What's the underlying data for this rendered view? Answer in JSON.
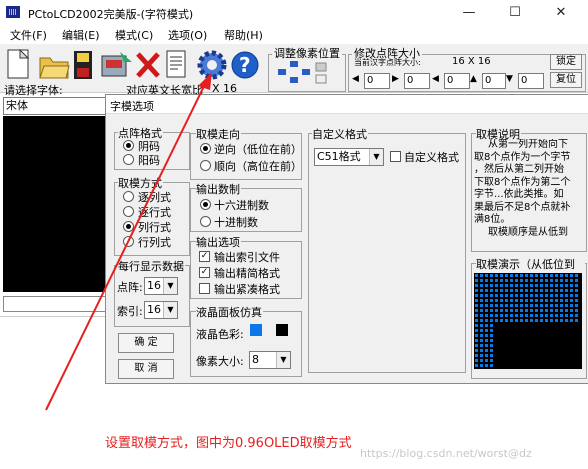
{
  "window": {
    "title": "PCtoLCD2002完美版-(字符模式)"
  },
  "menu": [
    "文件(F)",
    "编辑(E)",
    "模式(C)",
    "选项(O)",
    "帮助(H)"
  ],
  "toolbar": {
    "pixel_group_label": "调整像素位置",
    "size_group_label": "修改点阵大小",
    "size_sub_label": "当前汉字点阵大小:",
    "size_value": "16 X 16",
    "lock_label": "锁定",
    "reset_label": "复位",
    "spin_values": [
      "0",
      "0",
      "0",
      "0",
      "0"
    ]
  },
  "left_panel": {
    "font_label": "请选择字体:",
    "font_value": "宋体",
    "width_text": "对应英文长宽比",
    "width_value": "X 16"
  },
  "dialog": {
    "title": "字模选项",
    "dot_format": {
      "label": "点阵格式",
      "options": [
        "阴码",
        "阳码"
      ],
      "selected": 0
    },
    "mode": {
      "label": "取模方式",
      "options": [
        "逐列式",
        "逐行式",
        "列行式",
        "行列式"
      ],
      "selected": 2
    },
    "per_line": {
      "label": "每行显示数据",
      "dot_label": "点阵:",
      "dot_value": "16",
      "index_label": "索引:",
      "index_value": "16"
    },
    "ok_label": "确 定",
    "cancel_label": "取 消",
    "direction": {
      "label": "取模走向",
      "options": [
        "逆向（低位在前）",
        "顺向（高位在前）"
      ],
      "selected": 0
    },
    "numbering": {
      "label": "输出数制",
      "options": [
        "十六进制数",
        "十进制数"
      ],
      "selected": 0
    },
    "output": {
      "label": "输出选项",
      "items": [
        {
          "text": "输出索引文件",
          "checked": true
        },
        {
          "text": "输出精简格式",
          "checked": true
        },
        {
          "text": "输出紧凑格式",
          "checked": false
        }
      ]
    },
    "lcd": {
      "label": "液晶面板仿真",
      "color_label": "液晶色彩:",
      "pixel_label": "像素大小:",
      "pixel_value": "8",
      "color_fg": "#0a78e6",
      "color_bg": "#000000"
    },
    "custom": {
      "label": "自定义格式",
      "value": "C51格式",
      "checkbox": "自定义格式"
    },
    "explain": {
      "label": "取模说明",
      "lines": [
        "从第一列开始向下",
        "取8个点作为一个字节",
        "，然后从第二列开始",
        "下取8个点作为第二个",
        "字节...依此类推。如",
        "果最后不足8个点就补",
        "满8位。",
        "取模顺序是从低到"
      ]
    },
    "demo": {
      "label": "取模演示（从低位到"
    }
  },
  "annotation": "设置取模方式，图中为0.96OLED取模方式",
  "watermark": "https://blog.csdn.net/worst@dz"
}
